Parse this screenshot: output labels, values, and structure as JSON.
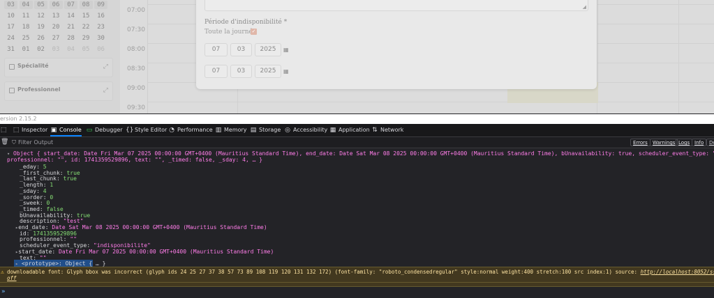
{
  "app": {
    "version": "ersion 2.15.2",
    "calendar": {
      "rows": [
        [
          "03",
          "04",
          "05",
          "06",
          "07",
          "08",
          "09"
        ],
        [
          "10",
          "11",
          "12",
          "13",
          "14",
          "15",
          "16"
        ],
        [
          "17",
          "18",
          "19",
          "20",
          "21",
          "22",
          "23"
        ],
        [
          "24",
          "25",
          "26",
          "27",
          "28",
          "29",
          "30"
        ],
        [
          "31",
          "01",
          "02",
          "03",
          "04",
          "05",
          "06"
        ]
      ]
    },
    "accordions": [
      "Spécialité",
      "Professionnel"
    ],
    "time_slots": [
      "07:00",
      "07:30",
      "08:00",
      "08:30",
      "09:00",
      "09:30"
    ],
    "modal": {
      "period_label": "Période d'indisponibilité *",
      "all_day_label": "Toute la journée",
      "all_day_checked": true,
      "start_date": {
        "day": "07",
        "month": "03",
        "year": "2025"
      },
      "end_date": {
        "day": "07",
        "month": "03",
        "year": "2025"
      }
    }
  },
  "devtools": {
    "tabs": [
      {
        "label": "Inspector",
        "icon": "inspector-icon"
      },
      {
        "label": "Console",
        "icon": "console-icon",
        "active": true
      },
      {
        "label": "Debugger",
        "icon": "debugger-icon"
      },
      {
        "label": "Style Editor",
        "icon": "style-editor-icon"
      },
      {
        "label": "Performance",
        "icon": "performance-icon"
      },
      {
        "label": "Memory",
        "icon": "memory-icon"
      },
      {
        "label": "Storage",
        "icon": "storage-icon"
      },
      {
        "label": "Accessibility",
        "icon": "accessibility-icon"
      },
      {
        "label": "Application",
        "icon": "application-icon"
      },
      {
        "label": "Network",
        "icon": "network-icon"
      }
    ],
    "filter_placeholder": "Filter Output",
    "levels": [
      "Errors",
      "Warnings",
      "Logs",
      "Info",
      "Deb"
    ],
    "console": {
      "summary_line1": "Object { start_date: Date Fri Mar 07 2025 00:00:00 GMT+0400 (Mauritius Standard Time), end_date: Date Sat Mar 08 2025 00:00:00 GMT+0400 (Mauritius Standard Time), bUnavailability: true, scheduler_event_type: \"indisponibilite\", description: \"test\",",
      "summary_line2": "professionnel: \"\", id: 1741359529896, text: \"\", _timed: false, _sday: 4, … }",
      "props": [
        {
          "k": "_eday",
          "v": "5",
          "t": "num"
        },
        {
          "k": "_first_chunk",
          "v": "true",
          "t": "bool"
        },
        {
          "k": "_last_chunk",
          "v": "true",
          "t": "bool"
        },
        {
          "k": "_length",
          "v": "1",
          "t": "num"
        },
        {
          "k": "_sday",
          "v": "4",
          "t": "num"
        },
        {
          "k": "_sorder",
          "v": "0",
          "t": "num"
        },
        {
          "k": "_sweek",
          "v": "0",
          "t": "num"
        },
        {
          "k": "_timed",
          "v": "false",
          "t": "bool"
        },
        {
          "k": "bUnavailability",
          "v": "true",
          "t": "bool"
        },
        {
          "k": "description",
          "v": "\"test\"",
          "t": "str"
        },
        {
          "k": "end_date",
          "v": "Date Sat Mar 08 2025 00:00:00 GMT+0400 (Mauritius Standard Time)",
          "t": "obj",
          "expand": true
        },
        {
          "k": "id",
          "v": "1741359529896",
          "t": "num"
        },
        {
          "k": "professionnel",
          "v": "\"\"",
          "t": "str"
        },
        {
          "k": "scheduler_event_type",
          "v": "\"indisponibilite\"",
          "t": "str"
        },
        {
          "k": "start_date",
          "v": "Date Fri Mar 07 2025 00:00:00 GMT+0400 (Mauritius Standard Time)",
          "t": "obj",
          "expand": true
        },
        {
          "k": "text",
          "v": "\"\"",
          "t": "str"
        }
      ],
      "prototype_key": "<prototype>",
      "prototype_val": "Object { … }",
      "warning_text": "downloadable font: Glyph bbox was incorrect (glyph ids 24 25 27 37 38 57 73 89 108 119 120 131 132 172) (font-family: \"roboto_condensedregular\" style:normal weight:400 stretch:100 src index:1) source:",
      "warning_link": "http://localhost:8052/ssp/code/css/fonts/roboto-",
      "warning_link2": "off",
      "prompt": "»"
    }
  }
}
